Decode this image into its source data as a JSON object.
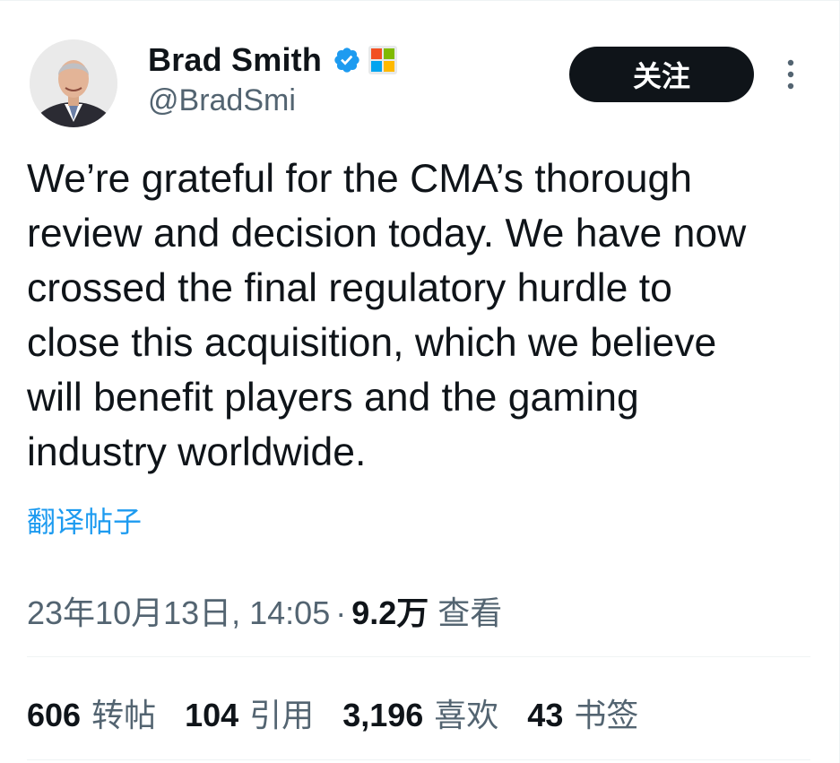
{
  "author": {
    "display_name": "Brad Smith",
    "handle": "@BradSmi",
    "verified_icon": "verified-badge-icon",
    "affiliation_icon": "microsoft-logo-icon"
  },
  "actions": {
    "follow_label": "关注",
    "more_icon": "more-vertical-icon"
  },
  "tweet": {
    "text": "We’re grateful for the CMA’s thorough\nreview and decision today. We have now\ncrossed the final regulatory hurdle to\nclose this acquisition, which we believe\nwill benefit players and the gaming\nindustry worldwide.",
    "translate_label": "翻译帖子"
  },
  "meta": {
    "timestamp": "23年10月13日, 14:05",
    "separator": "·",
    "views_count": "9.2万",
    "views_label": "查看"
  },
  "stats": [
    {
      "count": "606",
      "label": "转帖"
    },
    {
      "count": "104",
      "label": "引用"
    },
    {
      "count": "3,196",
      "label": "喜欢"
    },
    {
      "count": "43",
      "label": "书签"
    }
  ],
  "colors": {
    "text": "#0f1419",
    "secondary": "#536471",
    "link": "#1d9bf0",
    "verified": "#1d9bf0",
    "button_bg": "#0f1419",
    "divider": "#eff3f4"
  }
}
